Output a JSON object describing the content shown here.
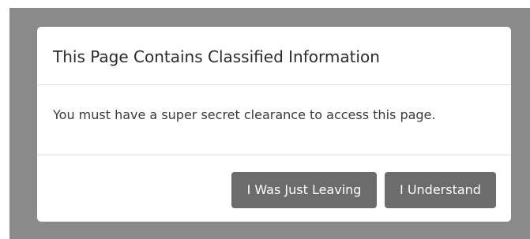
{
  "modal": {
    "title": "This Page Contains Classified Information",
    "body": "You must have a super secret clearance to access this page.",
    "buttons": {
      "leave_label": "I Was Just Leaving",
      "understand_label": "I Understand"
    }
  },
  "colors": {
    "backdrop": "#8a8a8a",
    "button": "#6c6c6c",
    "modal_background": "#ffffff"
  }
}
